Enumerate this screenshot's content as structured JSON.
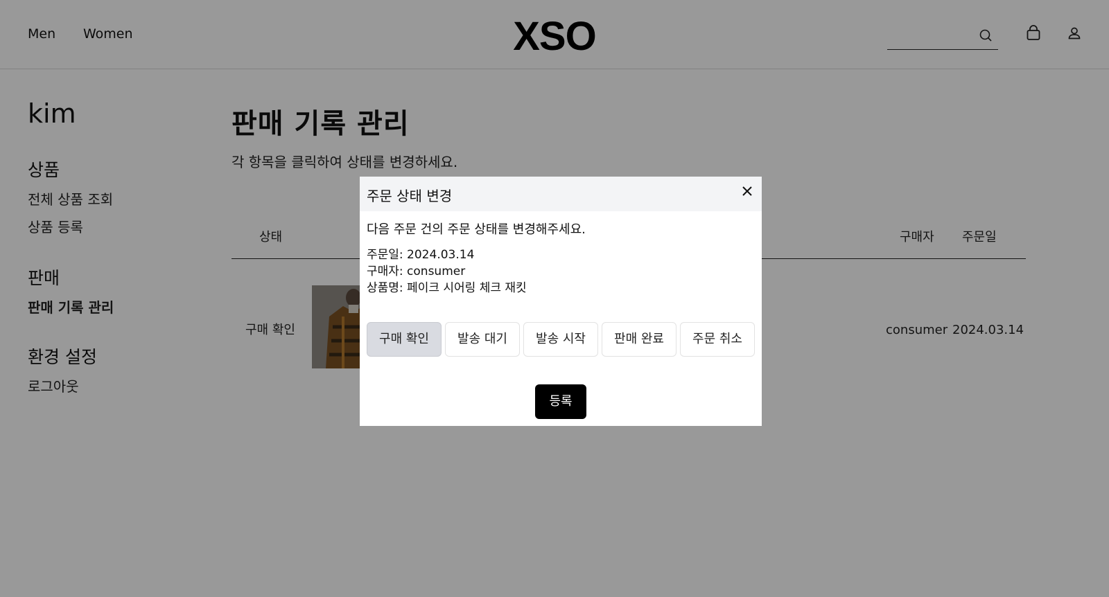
{
  "header": {
    "nav": [
      "Men",
      "Women"
    ],
    "logo": "XSO",
    "search": {
      "value": "",
      "placeholder": ""
    }
  },
  "sidebar": {
    "user_name": "kim",
    "sections": [
      {
        "title": "상품",
        "items": [
          "전체 상품 조회",
          "상품 등록"
        ]
      },
      {
        "title": "판매",
        "items": [
          "판매 기록 관리"
        ]
      },
      {
        "title": "환경 설정",
        "items": [
          "로그아웃"
        ]
      }
    ],
    "active_item": "판매 기록 관리"
  },
  "main": {
    "title": "판매 기록 관리",
    "description": "각 항목을 클릭하여 상태를 변경하세요.",
    "table": {
      "columns": {
        "status": "상태",
        "buyer": "구매자",
        "date": "주문일"
      },
      "rows": [
        {
          "status": "구매 확인",
          "buyer": "consumer",
          "date": "2024.03.14"
        }
      ]
    }
  },
  "modal": {
    "title": "주문 상태 변경",
    "message": "다음 주문 건의 주문 상태를 변경해주세요.",
    "order_date": "주문일: 2024.03.14",
    "buyer": "구매자: consumer",
    "product": "상품명: 페이크 시어링 체크 재킷",
    "status_options": [
      "구매 확인",
      "발송 대기",
      "발송 시작",
      "판매 완료",
      "주문 취소"
    ],
    "selected_status": "구매 확인",
    "submit_label": "등록"
  },
  "colors": {
    "overlay": "rgba(0,0,0,0.4)",
    "selected_button": "#d9dbe1",
    "submit_button": "#000000",
    "modal_header": "#f3f4f6"
  }
}
